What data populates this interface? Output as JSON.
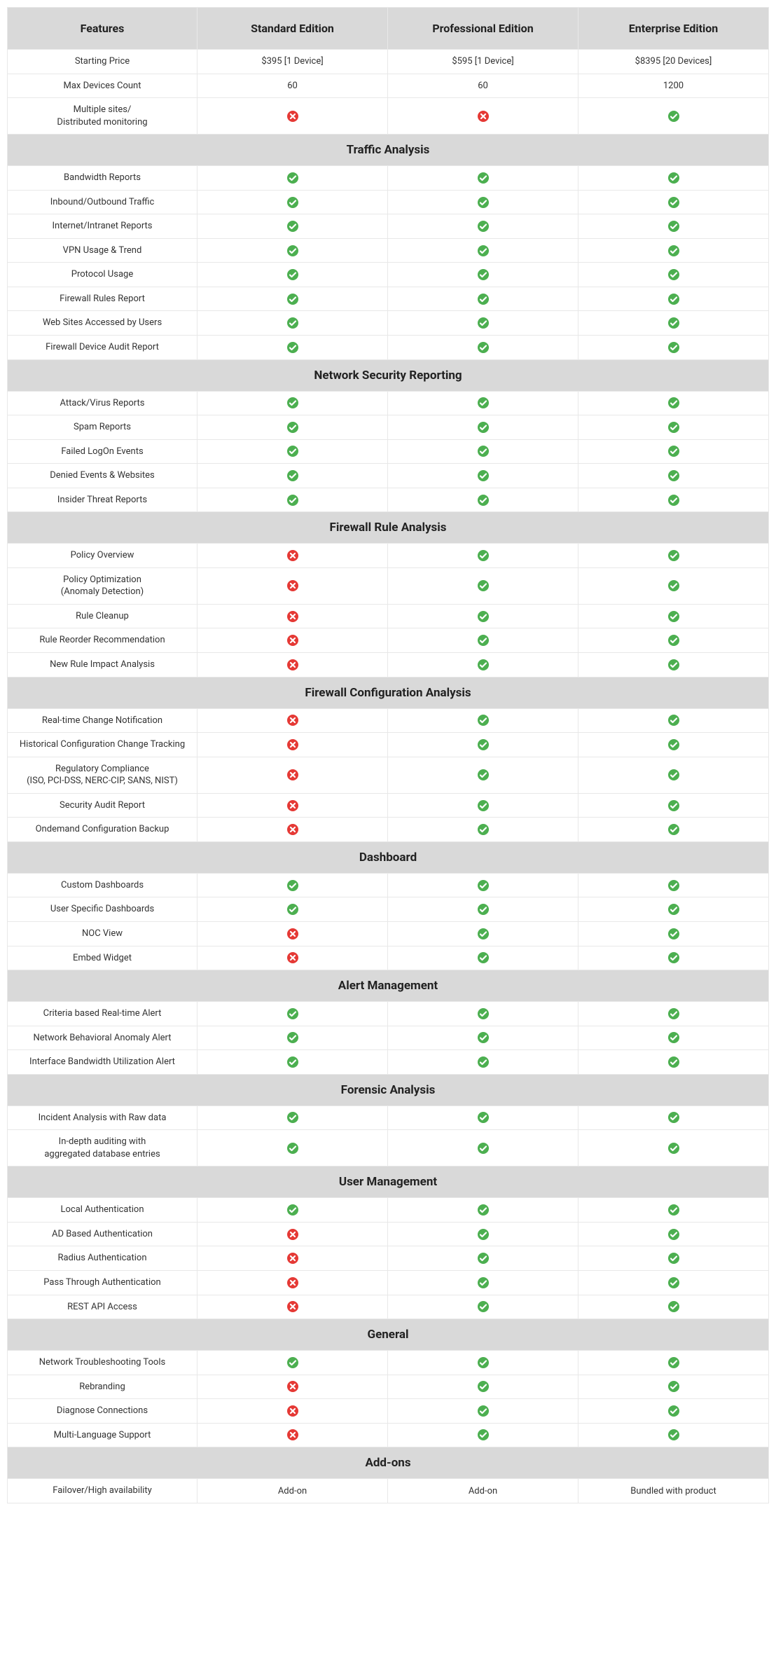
{
  "columns": [
    "Features",
    "Standard Edition",
    "Professional Edition",
    "Enterprise Edition"
  ],
  "intro_rows": [
    {
      "feature": "Starting Price",
      "values": [
        "$395 [1 Device]",
        "$595 [1 Device]",
        "$8395 [20 Devices]"
      ]
    },
    {
      "feature": "Max Devices Count",
      "values": [
        "60",
        "60",
        "1200"
      ]
    },
    {
      "feature": "Multiple sites/\nDistributed monitoring",
      "values": [
        "no",
        "no",
        "yes"
      ]
    }
  ],
  "sections": [
    {
      "title": "Traffic Analysis",
      "rows": [
        {
          "feature": "Bandwidth Reports",
          "values": [
            "yes",
            "yes",
            "yes"
          ]
        },
        {
          "feature": "Inbound/Outbound Traffic",
          "values": [
            "yes",
            "yes",
            "yes"
          ]
        },
        {
          "feature": "Internet/Intranet Reports",
          "values": [
            "yes",
            "yes",
            "yes"
          ]
        },
        {
          "feature": "VPN Usage & Trend",
          "values": [
            "yes",
            "yes",
            "yes"
          ]
        },
        {
          "feature": "Protocol Usage",
          "values": [
            "yes",
            "yes",
            "yes"
          ]
        },
        {
          "feature": "Firewall Rules Report",
          "values": [
            "yes",
            "yes",
            "yes"
          ]
        },
        {
          "feature": "Web Sites Accessed by Users",
          "values": [
            "yes",
            "yes",
            "yes"
          ]
        },
        {
          "feature": "Firewall Device Audit Report",
          "values": [
            "yes",
            "yes",
            "yes"
          ]
        }
      ]
    },
    {
      "title": "Network Security Reporting",
      "rows": [
        {
          "feature": "Attack/Virus Reports",
          "values": [
            "yes",
            "yes",
            "yes"
          ]
        },
        {
          "feature": "Spam Reports",
          "values": [
            "yes",
            "yes",
            "yes"
          ]
        },
        {
          "feature": "Failed LogOn Events",
          "values": [
            "yes",
            "yes",
            "yes"
          ]
        },
        {
          "feature": "Denied Events & Websites",
          "values": [
            "yes",
            "yes",
            "yes"
          ]
        },
        {
          "feature": "Insider Threat Reports",
          "values": [
            "yes",
            "yes",
            "yes"
          ]
        }
      ]
    },
    {
      "title": "Firewall Rule Analysis",
      "rows": [
        {
          "feature": "Policy Overview",
          "values": [
            "no",
            "yes",
            "yes"
          ]
        },
        {
          "feature": "Policy Optimization\n(Anomaly Detection)",
          "values": [
            "no",
            "yes",
            "yes"
          ]
        },
        {
          "feature": "Rule Cleanup",
          "values": [
            "no",
            "yes",
            "yes"
          ]
        },
        {
          "feature": "Rule Reorder Recommendation",
          "values": [
            "no",
            "yes",
            "yes"
          ]
        },
        {
          "feature": "New Rule Impact Analysis",
          "values": [
            "no",
            "yes",
            "yes"
          ]
        }
      ]
    },
    {
      "title": "Firewall Configuration Analysis",
      "rows": [
        {
          "feature": "Real-time Change Notification",
          "values": [
            "no",
            "yes",
            "yes"
          ]
        },
        {
          "feature": "Historical Configuration Change Tracking",
          "values": [
            "no",
            "yes",
            "yes"
          ]
        },
        {
          "feature": "Regulatory Compliance\n(ISO, PCI-DSS, NERC-CIP, SANS, NIST)",
          "values": [
            "no",
            "yes",
            "yes"
          ]
        },
        {
          "feature": "Security Audit Report",
          "values": [
            "no",
            "yes",
            "yes"
          ]
        },
        {
          "feature": "Ondemand Configuration Backup",
          "values": [
            "no",
            "yes",
            "yes"
          ]
        }
      ]
    },
    {
      "title": "Dashboard",
      "rows": [
        {
          "feature": "Custom Dashboards",
          "values": [
            "yes",
            "yes",
            "yes"
          ]
        },
        {
          "feature": "User Specific Dashboards",
          "values": [
            "yes",
            "yes",
            "yes"
          ]
        },
        {
          "feature": "NOC View",
          "values": [
            "no",
            "yes",
            "yes"
          ]
        },
        {
          "feature": "Embed Widget",
          "values": [
            "no",
            "yes",
            "yes"
          ]
        }
      ]
    },
    {
      "title": "Alert Management",
      "rows": [
        {
          "feature": "Criteria based Real-time Alert",
          "values": [
            "yes",
            "yes",
            "yes"
          ]
        },
        {
          "feature": "Network Behavioral Anomaly Alert",
          "values": [
            "yes",
            "yes",
            "yes"
          ]
        },
        {
          "feature": "Interface Bandwidth Utilization Alert",
          "values": [
            "yes",
            "yes",
            "yes"
          ]
        }
      ]
    },
    {
      "title": "Forensic Analysis",
      "rows": [
        {
          "feature": "Incident Analysis with Raw data",
          "values": [
            "yes",
            "yes",
            "yes"
          ]
        },
        {
          "feature": "In-depth auditing with\naggregated database entries",
          "values": [
            "yes",
            "yes",
            "yes"
          ]
        }
      ]
    },
    {
      "title": "User Management",
      "rows": [
        {
          "feature": "Local Authentication",
          "values": [
            "yes",
            "yes",
            "yes"
          ]
        },
        {
          "feature": "AD Based Authentication",
          "values": [
            "no",
            "yes",
            "yes"
          ]
        },
        {
          "feature": "Radius Authentication",
          "values": [
            "no",
            "yes",
            "yes"
          ]
        },
        {
          "feature": "Pass Through Authentication",
          "values": [
            "no",
            "yes",
            "yes"
          ]
        },
        {
          "feature": "REST API Access",
          "values": [
            "no",
            "yes",
            "yes"
          ]
        }
      ]
    },
    {
      "title": "General",
      "rows": [
        {
          "feature": "Network Troubleshooting Tools",
          "values": [
            "yes",
            "yes",
            "yes"
          ]
        },
        {
          "feature": "Rebranding",
          "values": [
            "no",
            "yes",
            "yes"
          ]
        },
        {
          "feature": "Diagnose Connections",
          "values": [
            "no",
            "yes",
            "yes"
          ]
        },
        {
          "feature": "Multi-Language Support",
          "values": [
            "no",
            "yes",
            "yes"
          ]
        }
      ]
    },
    {
      "title": "Add-ons",
      "rows": [
        {
          "feature": "Failover/High availability",
          "values": [
            "Add-on",
            "Add-on",
            "Bundled with product"
          ]
        }
      ]
    }
  ]
}
